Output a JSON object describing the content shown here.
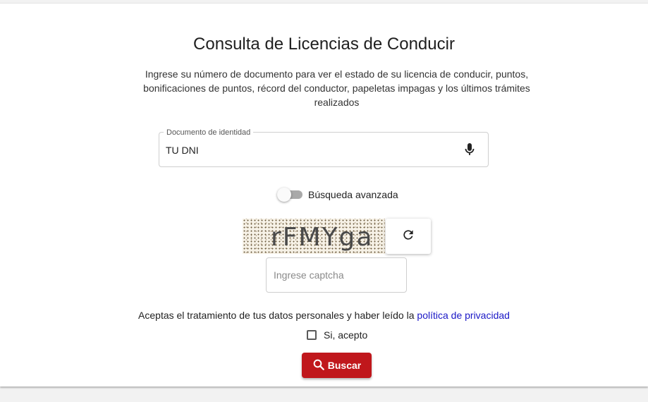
{
  "page": {
    "title": "Consulta de Licencias de Conducir",
    "description": "Ingrese su número de documento para ver el estado de su licencia de conducir, puntos, bonificaciones de puntos, récord del conductor, papeletas impagas y los últimos trámites realizados"
  },
  "document_field": {
    "label": "Documento de identidad",
    "value": "TU DNI",
    "icon": "microphone-icon"
  },
  "advanced_search": {
    "label": "Búsqueda avanzada",
    "enabled": false
  },
  "captcha": {
    "text": "rFMYga",
    "refresh_icon": "refresh-icon",
    "input_placeholder": "Ingrese captcha"
  },
  "consent": {
    "text": "Aceptas el tratamiento de tus datos personales y haber leído la",
    "link_text": "política de privacidad",
    "checkbox_label": "Si, acepto",
    "checked": false
  },
  "search_button": {
    "label": "Buscar",
    "icon": "search-icon",
    "color": "#c0171c"
  },
  "colors": {
    "link": "#1a17c6",
    "accent": "#c0171c"
  }
}
